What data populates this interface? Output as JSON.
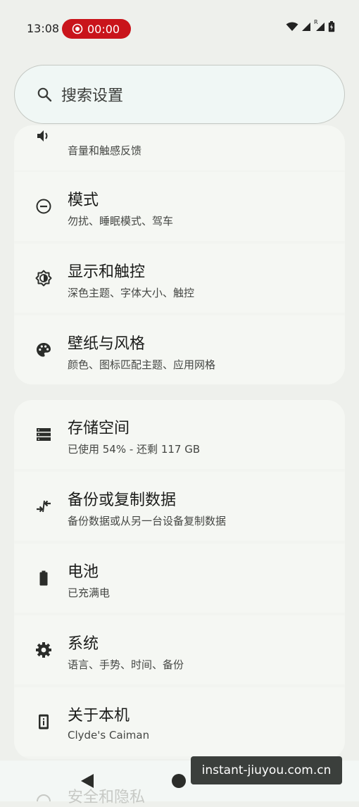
{
  "status_bar": {
    "time": "13:08",
    "recording_time": "00:00",
    "icons": [
      "wifi-icon",
      "signal-icon",
      "roaming-signal-icon",
      "battery-icon"
    ],
    "roaming_label": "R"
  },
  "search": {
    "placeholder": "搜索设置",
    "icon": "search-icon"
  },
  "settings_group_1": [
    {
      "title": "",
      "subtitle": "音量和触感反馈",
      "icon": "sound-icon"
    },
    {
      "title": "模式",
      "subtitle": "勿扰、睡眠模式、驾车",
      "icon": "do-not-disturb-icon"
    },
    {
      "title": "显示和触控",
      "subtitle": "深色主题、字体大小、触控",
      "icon": "brightness-icon"
    },
    {
      "title": "壁纸与风格",
      "subtitle": "颜色、图标匹配主题、应用网格",
      "icon": "palette-icon"
    }
  ],
  "settings_group_2": [
    {
      "title": "存储空间",
      "subtitle": "已使用 54% - 还剩 117 GB",
      "icon": "storage-icon"
    },
    {
      "title": "备份或复制数据",
      "subtitle": "备份数据或从另一台设备复制数据",
      "icon": "transfer-icon"
    },
    {
      "title": "电池",
      "subtitle": "已充满电",
      "icon": "battery-full-icon"
    },
    {
      "title": "系统",
      "subtitle": "语言、手势、时间、备份",
      "icon": "gear-icon"
    },
    {
      "title": "关于本机",
      "subtitle": "Clyde's Caiman",
      "icon": "phone-info-icon"
    }
  ],
  "partial_item": {
    "title": "安全和隐私"
  },
  "watermark": "instant-jiuyou.com.cn",
  "colors": {
    "record_red": "#c9141b",
    "background": "#eef0ec",
    "card": "#f5f7f3"
  }
}
